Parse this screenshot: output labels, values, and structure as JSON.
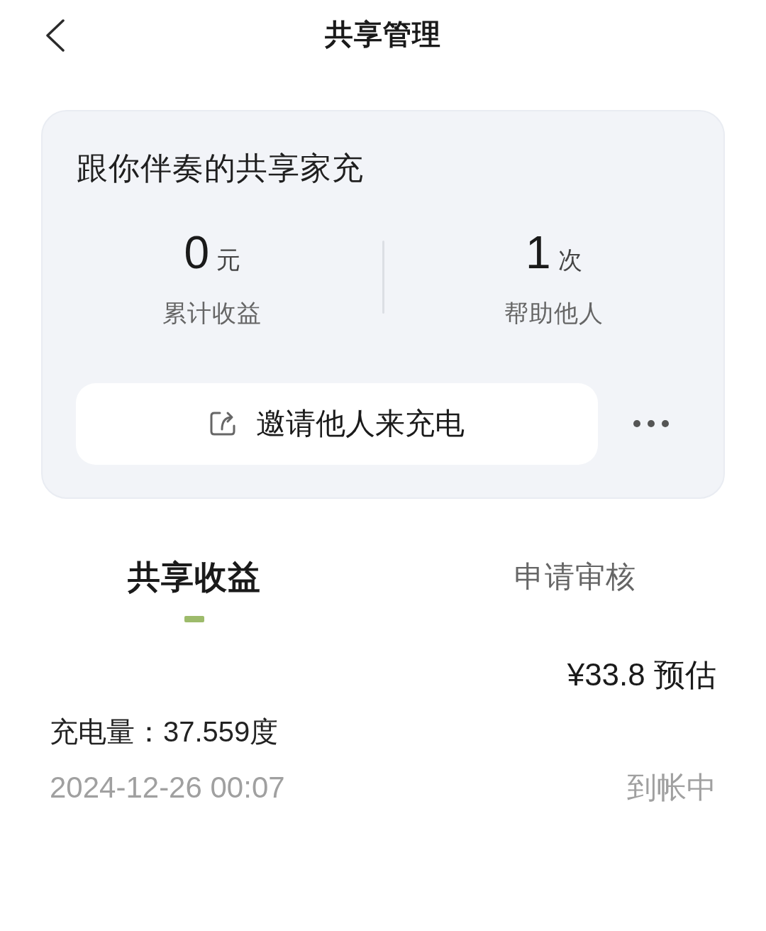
{
  "header": {
    "title": "共享管理"
  },
  "card": {
    "title": "跟你伴奏的共享家充",
    "stats": [
      {
        "value": "0",
        "unit": "元",
        "label": "累计收益"
      },
      {
        "value": "1",
        "unit": "次",
        "label": "帮助他人"
      }
    ],
    "invite_button": {
      "label": "邀请他人来充电"
    }
  },
  "tabs": [
    {
      "label": "共享收益",
      "selected": true
    },
    {
      "label": "申请审核",
      "selected": false
    }
  ],
  "records": [
    {
      "amount": "¥33.8 预估",
      "energy": "充电量：37.559度",
      "time": "2024-12-26 00:07",
      "status": "到帐中"
    }
  ]
}
